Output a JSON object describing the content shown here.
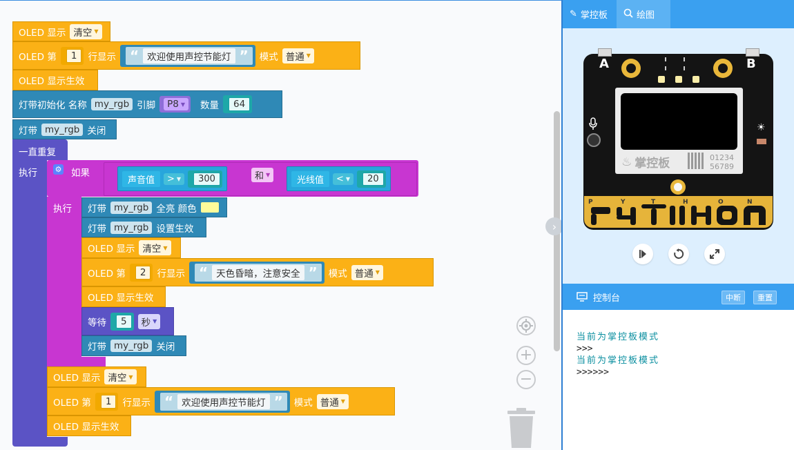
{
  "workspace": {
    "blocks": {
      "oled_show": "OLED 显示",
      "clear": "清空",
      "oled_row_prefix": "OLED 第",
      "row_show": "行显示",
      "mode": "模式",
      "normal": "普通",
      "oled_apply": "OLED 显示生效",
      "strip_init": "灯带初始化 名称",
      "pin": "引脚",
      "pin_value": "P8",
      "count": "数量",
      "count_value": "64",
      "strip": "灯带",
      "var_name": "my_rgb",
      "off": "关闭",
      "forever": "一直重复",
      "do": "执行",
      "if": "如果",
      "sound": "声音值",
      "gt": ">",
      "lt": "<",
      "sound_threshold": "300",
      "and": "和",
      "light": "光线值",
      "light_threshold": "20",
      "all_on_color": "全亮 颜色",
      "set_apply": "设置生效",
      "wait": "等待",
      "wait_value": "5",
      "seconds": "秒",
      "row1": "1",
      "row2": "2",
      "welcome_text": "欢迎使用声控节能灯",
      "warning_text": "天色昏暗，注意安全",
      "quote_open": "“",
      "quote_close": "”"
    },
    "colors": {
      "oled": "#fbb116",
      "strip": "#2f89b6",
      "loop": "#5b53c5",
      "if": "#c836d1",
      "led_color": "#fffb9a"
    }
  },
  "panel": {
    "tabs": [
      {
        "label": "掌控板",
        "icon": "wand-icon"
      },
      {
        "label": "绘图",
        "icon": "search-icon"
      }
    ],
    "board": {
      "button_a": "A",
      "button_b": "B",
      "brand": "掌控板",
      "serial_line1": "01234",
      "serial_line2": "56789",
      "python_letters": [
        "P",
        "Y",
        "T",
        "H",
        "O",
        "N"
      ]
    },
    "console": {
      "title": "控制台",
      "interrupt": "中断",
      "reset": "重置",
      "lines": [
        "当前为掌控板模式",
        ">>>",
        "当前为掌控板模式",
        ">>>>>>"
      ]
    }
  }
}
